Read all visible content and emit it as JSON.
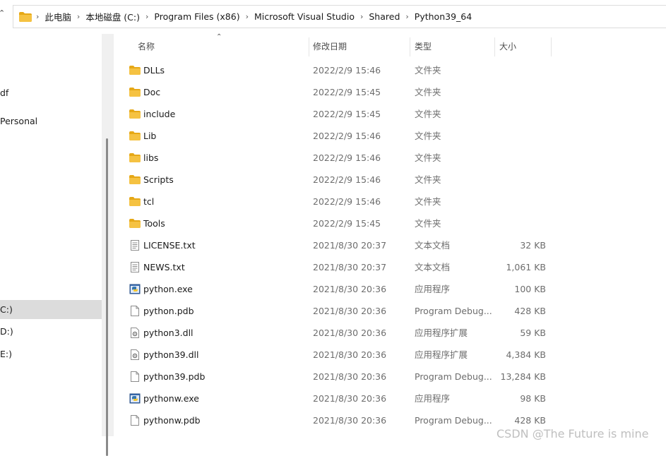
{
  "address_bar": {
    "crumbs": [
      "此电脑",
      "本地磁盘 (C:)",
      "Program Files (x86)",
      "Microsoft Visual Studio",
      "Shared",
      "Python39_64"
    ]
  },
  "nav_pane": {
    "items": [
      {
        "label": "df",
        "selected": false
      },
      {
        "label": "Personal",
        "selected": false
      },
      {
        "label": "C:)",
        "selected": true
      },
      {
        "label": "D:)",
        "selected": false
      },
      {
        "label": "E:)",
        "selected": false
      }
    ]
  },
  "columns": {
    "name": "名称",
    "date": "修改日期",
    "type": "类型",
    "size": "大小"
  },
  "files": [
    {
      "name": "DLLs",
      "date": "2022/2/9 15:46",
      "type": "文件夹",
      "size": "",
      "icon": "folder-icon"
    },
    {
      "name": "Doc",
      "date": "2022/2/9 15:45",
      "type": "文件夹",
      "size": "",
      "icon": "folder-icon"
    },
    {
      "name": "include",
      "date": "2022/2/9 15:45",
      "type": "文件夹",
      "size": "",
      "icon": "folder-icon"
    },
    {
      "name": "Lib",
      "date": "2022/2/9 15:46",
      "type": "文件夹",
      "size": "",
      "icon": "folder-icon"
    },
    {
      "name": "libs",
      "date": "2022/2/9 15:46",
      "type": "文件夹",
      "size": "",
      "icon": "folder-icon"
    },
    {
      "name": "Scripts",
      "date": "2022/2/9 15:46",
      "type": "文件夹",
      "size": "",
      "icon": "folder-icon"
    },
    {
      "name": "tcl",
      "date": "2022/2/9 15:46",
      "type": "文件夹",
      "size": "",
      "icon": "folder-icon"
    },
    {
      "name": "Tools",
      "date": "2022/2/9 15:45",
      "type": "文件夹",
      "size": "",
      "icon": "folder-icon"
    },
    {
      "name": "LICENSE.txt",
      "date": "2021/8/30 20:37",
      "type": "文本文档",
      "size": "32 KB",
      "icon": "text-file-icon"
    },
    {
      "name": "NEWS.txt",
      "date": "2021/8/30 20:37",
      "type": "文本文档",
      "size": "1,061 KB",
      "icon": "text-file-icon"
    },
    {
      "name": "python.exe",
      "date": "2021/8/30 20:36",
      "type": "应用程序",
      "size": "100 KB",
      "icon": "python-exe-icon"
    },
    {
      "name": "python.pdb",
      "date": "2021/8/30 20:36",
      "type": "Program Debug...",
      "size": "428 KB",
      "icon": "blank-file-icon"
    },
    {
      "name": "python3.dll",
      "date": "2021/8/30 20:36",
      "type": "应用程序扩展",
      "size": "59 KB",
      "icon": "dll-file-icon"
    },
    {
      "name": "python39.dll",
      "date": "2021/8/30 20:36",
      "type": "应用程序扩展",
      "size": "4,384 KB",
      "icon": "dll-file-icon"
    },
    {
      "name": "python39.pdb",
      "date": "2021/8/30 20:36",
      "type": "Program Debug...",
      "size": "13,284 KB",
      "icon": "blank-file-icon"
    },
    {
      "name": "pythonw.exe",
      "date": "2021/8/30 20:36",
      "type": "应用程序",
      "size": "98 KB",
      "icon": "python-exe-icon"
    },
    {
      "name": "pythonw.pdb",
      "date": "2021/8/30 20:36",
      "type": "Program Debug...",
      "size": "428 KB",
      "icon": "blank-file-icon"
    }
  ],
  "watermark": "CSDN @The Future is mine",
  "colors": {
    "folder": "#f5c242",
    "folder_dark": "#e6a817",
    "selected_bg": "#dcdcdc",
    "secondary_text": "#6d6d6d"
  }
}
